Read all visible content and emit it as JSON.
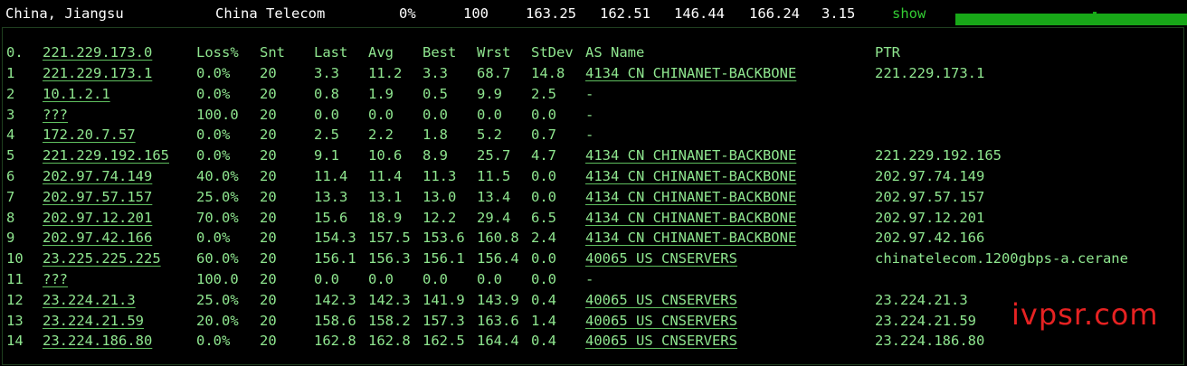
{
  "summary": {
    "location": "China, Jiangsu",
    "isp": "China Telecom",
    "loss": "0%",
    "sent": "100",
    "last": "163.25",
    "avg": "162.51",
    "best": "146.44",
    "worst": "166.24",
    "stdev": "3.15",
    "show_label": "show",
    "bar_fill_fraction": 1.0,
    "bar_color": "#18a818"
  },
  "headers": {
    "hop": "0.",
    "host": "221.229.173.0",
    "loss": "Loss%",
    "snt": "Snt",
    "last": "Last",
    "avg": "Avg",
    "best": "Best",
    "wrst": "Wrst",
    "stdev": "StDev",
    "asname": "AS Name",
    "ptr": "PTR"
  },
  "hops": [
    {
      "hop": "1",
      "host": "221.229.173.1",
      "loss": "0.0%",
      "snt": "20",
      "last": "3.3",
      "avg": "11.2",
      "best": "3.3",
      "wrst": "68.7",
      "stdev": "14.8",
      "asname": "4134  CN CHINANET-BACKBONE",
      "ptr": "221.229.173.1"
    },
    {
      "hop": "2",
      "host": "10.1.2.1",
      "loss": "0.0%",
      "snt": "20",
      "last": "0.8",
      "avg": "1.9",
      "best": "0.5",
      "wrst": "9.9",
      "stdev": "2.5",
      "asname": "-",
      "ptr": ""
    },
    {
      "hop": "3",
      "host": "???",
      "loss": "100.0",
      "snt": "20",
      "last": "0.0",
      "avg": "0.0",
      "best": "0.0",
      "wrst": "0.0",
      "stdev": "0.0",
      "asname": "-",
      "ptr": ""
    },
    {
      "hop": "4",
      "host": "172.20.7.57",
      "loss": "0.0%",
      "snt": "20",
      "last": "2.5",
      "avg": "2.2",
      "best": "1.8",
      "wrst": "5.2",
      "stdev": "0.7",
      "asname": "-",
      "ptr": ""
    },
    {
      "hop": "5",
      "host": "221.229.192.165",
      "loss": "0.0%",
      "snt": "20",
      "last": "9.1",
      "avg": "10.6",
      "best": "8.9",
      "wrst": "25.7",
      "stdev": "4.7",
      "asname": "4134  CN CHINANET-BACKBONE",
      "ptr": "221.229.192.165"
    },
    {
      "hop": "6",
      "host": "202.97.74.149",
      "loss": "40.0%",
      "snt": "20",
      "last": "11.4",
      "avg": "11.4",
      "best": "11.3",
      "wrst": "11.5",
      "stdev": "0.0",
      "asname": "4134  CN CHINANET-BACKBONE",
      "ptr": "202.97.74.149"
    },
    {
      "hop": "7",
      "host": "202.97.57.157",
      "loss": "25.0%",
      "snt": "20",
      "last": "13.3",
      "avg": "13.1",
      "best": "13.0",
      "wrst": "13.4",
      "stdev": "0.0",
      "asname": "4134  CN CHINANET-BACKBONE",
      "ptr": "202.97.57.157"
    },
    {
      "hop": "8",
      "host": "202.97.12.201",
      "loss": "70.0%",
      "snt": "20",
      "last": "15.6",
      "avg": "18.9",
      "best": "12.2",
      "wrst": "29.4",
      "stdev": "6.5",
      "asname": "4134  CN CHINANET-BACKBONE",
      "ptr": "202.97.12.201"
    },
    {
      "hop": "9",
      "host": "202.97.42.166",
      "loss": "0.0%",
      "snt": "20",
      "last": "154.3",
      "avg": "157.5",
      "best": "153.6",
      "wrst": "160.8",
      "stdev": "2.4",
      "asname": "4134  CN CHINANET-BACKBONE",
      "ptr": "202.97.42.166"
    },
    {
      "hop": "10",
      "host": "23.225.225.225",
      "loss": "60.0%",
      "snt": "20",
      "last": "156.1",
      "avg": "156.3",
      "best": "156.1",
      "wrst": "156.4",
      "stdev": "0.0",
      "asname": "40065 US CNSERVERS",
      "ptr": "chinatelecom.1200gbps-a.cerane"
    },
    {
      "hop": "11",
      "host": "???",
      "loss": "100.0",
      "snt": "20",
      "last": "0.0",
      "avg": "0.0",
      "best": "0.0",
      "wrst": "0.0",
      "stdev": "0.0",
      "asname": "-",
      "ptr": ""
    },
    {
      "hop": "12",
      "host": "23.224.21.3",
      "loss": "25.0%",
      "snt": "20",
      "last": "142.3",
      "avg": "142.3",
      "best": "141.9",
      "wrst": "143.9",
      "stdev": "0.4",
      "asname": "40065 US CNSERVERS",
      "ptr": "23.224.21.3"
    },
    {
      "hop": "13",
      "host": "23.224.21.59",
      "loss": "20.0%",
      "snt": "20",
      "last": "158.6",
      "avg": "158.2",
      "best": "157.3",
      "wrst": "163.6",
      "stdev": "1.4",
      "asname": "40065 US CNSERVERS",
      "ptr": "23.224.21.59"
    },
    {
      "hop": "14",
      "host": "23.224.186.80",
      "loss": "0.0%",
      "snt": "20",
      "last": "162.8",
      "avg": "162.8",
      "best": "162.5",
      "wrst": "164.4",
      "stdev": "0.4",
      "asname": "40065 US CNSERVERS",
      "ptr": "23.224.186.80"
    }
  ],
  "watermark": "ivpsr.com"
}
